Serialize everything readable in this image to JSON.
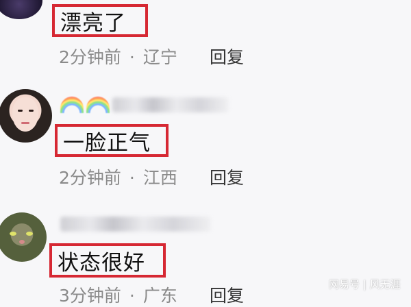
{
  "comments": [
    {
      "text": "漂亮了",
      "time": "2分钟前",
      "separator": "·",
      "location": "辽宁",
      "reply": "回复"
    },
    {
      "text": "一脸正气",
      "time": "2分钟前",
      "separator": "·",
      "location": "江西",
      "reply": "回复"
    },
    {
      "text": "状态很好",
      "time": "3分钟前",
      "separator": "·",
      "location": "广东",
      "reply": "回复"
    }
  ],
  "watermark": "网易号 | 风无涯",
  "colors": {
    "highlight_border": "#d62833",
    "meta_text": "#8a8a8a",
    "background": "#f7f7f9"
  }
}
